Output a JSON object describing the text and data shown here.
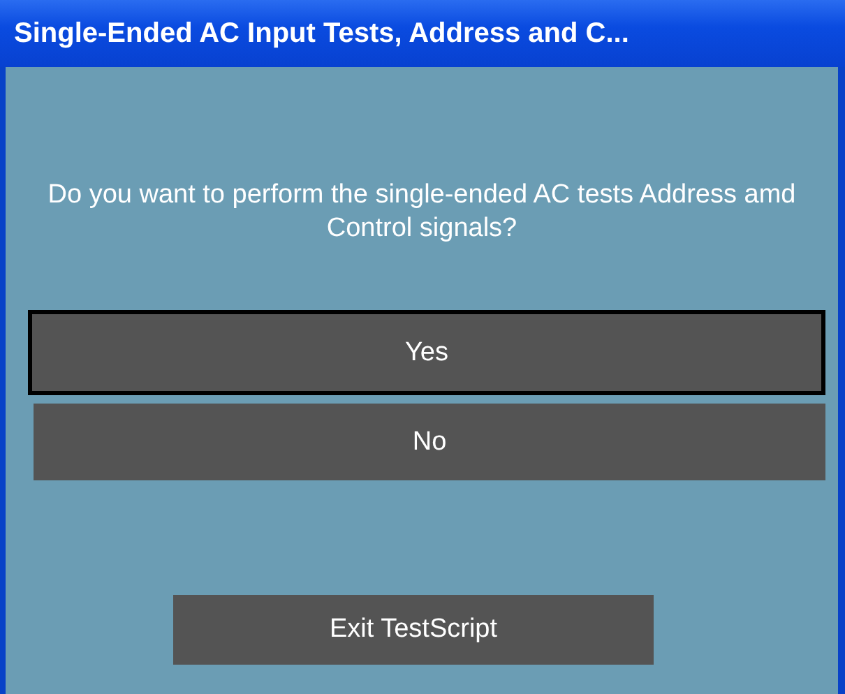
{
  "window": {
    "title": "Single-Ended AC Input Tests, Address and C..."
  },
  "message": "Do you want to perform the single-ended AC tests Address amd Control signals?",
  "choices": [
    {
      "label": "Yes",
      "selected": true
    },
    {
      "label": "No",
      "selected": false
    }
  ],
  "exit_button": {
    "label": "Exit TestScript"
  }
}
